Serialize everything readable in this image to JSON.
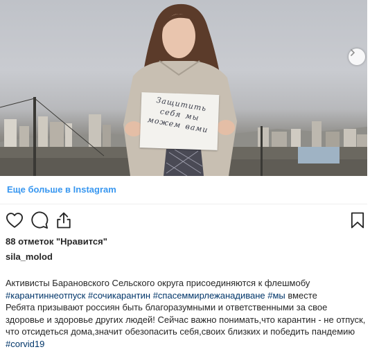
{
  "post": {
    "more_link": "Еще больше в Instagram",
    "likes": "88 отметок \"Нравится\"",
    "username": "sila_molod",
    "caption": {
      "p1_text": "Активисты Барановского Сельского округа присоединяются к флешмобу",
      "tag1": "#карантиннеотпуск",
      "tag2": "#сочикарантин",
      "tag3": "#спасеммирлежанадиване",
      "tag4": "#мы",
      "p2_text": " вместе",
      "p3_text": "Ребята призывают россиян быть благоразумными и ответственными за свое здоровье и здоровье других людей! Сейчас важно понимать,что карантин - не отпуск, что отсидеться дома,значит обезопасить себя,своих близких и победить пандемию ",
      "tag5": "#corvid19"
    },
    "photo": {
      "sign_text": "Защитить себя мы можем вами"
    },
    "icons": {
      "like": "heart-icon",
      "comment": "comment-icon",
      "share": "share-icon",
      "save": "bookmark-icon",
      "next": "chevron-right-icon"
    },
    "colors": {
      "link": "#3897f0",
      "hashtag": "#003569",
      "text": "#262626"
    }
  }
}
